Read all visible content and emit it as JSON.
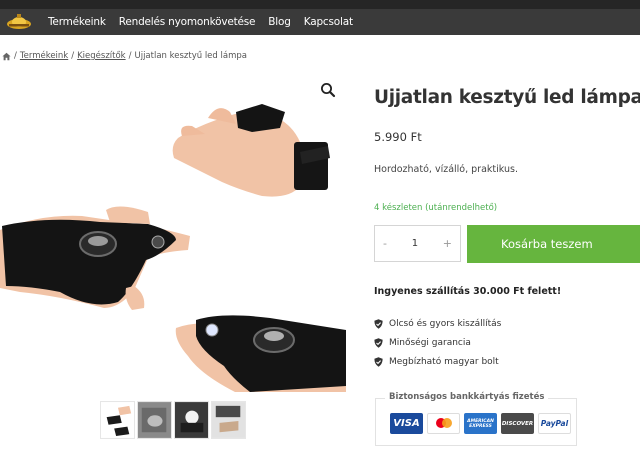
{
  "nav": {
    "logo_icon": "lantern-logo-icon",
    "items": [
      "Termékeink",
      "Rendelés nyomonkövetése",
      "Blog",
      "Kapcsolat"
    ]
  },
  "breadcrumb": {
    "home_icon": "home-icon",
    "sep": "/",
    "items": [
      "Termékeink",
      "Kiegészítők",
      "Ujjatlan kesztyű led lámpa"
    ]
  },
  "gallery": {
    "zoom_icon": "magnifier-icon",
    "thumbnail_count": 4
  },
  "product": {
    "title": "Ujjatlan kesztyű led lámpa",
    "price": "5.990 Ft",
    "short_description": "Hordozható, vízálló, praktikus.",
    "stock": "4 készleten (utánrendelhető)"
  },
  "cart": {
    "minus": "-",
    "quantity": "1",
    "plus": "+",
    "add_to_cart": "Kosárba teszem"
  },
  "shipping": "Ingyenes szállítás 30.000 Ft felett!",
  "features": [
    "Olcsó és gyors kiszállítás",
    "Minőségi garancia",
    "Megbízható magyar bolt"
  ],
  "payment": {
    "title": "Biztonságos bankkártyás fizetés",
    "cards": [
      {
        "name": "VISA",
        "bg": "#1a4a9c",
        "fg": "#ffffff"
      },
      {
        "name": "mastercard",
        "bg": "#ffffff",
        "fg": "#222222"
      },
      {
        "name": "AMERICAN EXPRESS",
        "bg": "#2a73c9",
        "fg": "#ffffff"
      },
      {
        "name": "DISCOVER",
        "bg": "#4a4a4a",
        "fg": "#ffffff"
      },
      {
        "name": "PayPal",
        "bg": "#ffffff",
        "fg": "#1a4a9c"
      }
    ]
  },
  "colors": {
    "nav_bg": "#3a3a3a",
    "accent_green": "#66b53e",
    "stock_green": "#4caf50"
  }
}
